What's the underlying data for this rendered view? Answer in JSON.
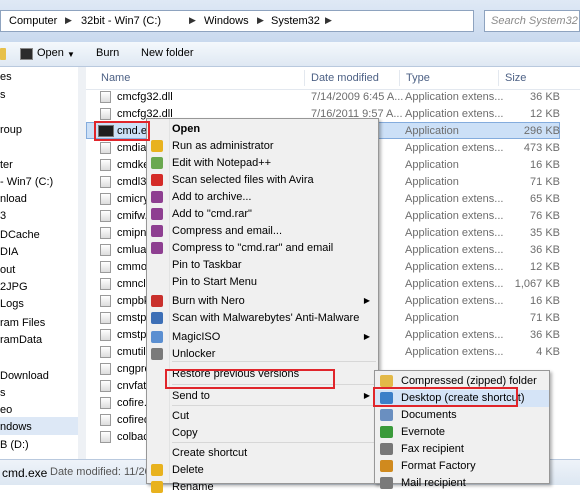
{
  "address": {
    "crumbs": [
      "Computer",
      "32bit - Win7 (C:)",
      "Windows",
      "System32"
    ],
    "search_placeholder": "Search System32"
  },
  "toolbar": {
    "open_label": "Open",
    "burn_label": "Burn",
    "new_folder_label": "New folder"
  },
  "nav": {
    "items": [
      "es",
      "s",
      "roup",
      "",
      "ter",
      "- Win7 (C:)",
      "nload",
      "3",
      "DCache",
      "DIA",
      "out",
      "2JPG",
      "Logs",
      "ram Files",
      "ramData",
      "",
      "Download",
      "s",
      "eo",
      "ndows",
      "B (D:)"
    ]
  },
  "columns": {
    "name": "Name",
    "date": "Date modified",
    "type": "Type",
    "size": "Size"
  },
  "files": [
    {
      "name": "cmcfg32.dll",
      "date": "7/14/2009 6:45 A...",
      "type": "Application extens...",
      "size": "36 KB"
    },
    {
      "name": "cmcfg32.dll",
      "date": "7/16/2011 9:57 A...",
      "type": "Application extens...",
      "size": "12 KB"
    },
    {
      "name": "cmd.ex",
      "date": "",
      "type": "Application",
      "size": "296 KB"
    },
    {
      "name": "cmdial",
      "date": "",
      "type": "Application extens...",
      "size": "473 KB"
    },
    {
      "name": "cmdke",
      "date": "",
      "type": "Application",
      "size": "16 KB"
    },
    {
      "name": "cmdl3",
      "date": "",
      "type": "Application",
      "size": "71 KB"
    },
    {
      "name": "cmicry",
      "date": "",
      "type": "Application extens...",
      "size": "65 KB"
    },
    {
      "name": "cmifw.",
      "date": "",
      "type": "Application extens...",
      "size": "76 KB"
    },
    {
      "name": "cmipnp",
      "date": "",
      "type": "Application extens...",
      "size": "35 KB"
    },
    {
      "name": "cmlua.",
      "date": "",
      "type": "Application extens...",
      "size": "36 KB"
    },
    {
      "name": "cmmo",
      "date": "",
      "type": "Application extens...",
      "size": "12 KB"
    },
    {
      "name": "cmncli",
      "date": "",
      "type": "Application extens...",
      "size": "1,067 KB"
    },
    {
      "name": "cmpbk",
      "date": "",
      "type": "Application extens...",
      "size": "16 KB"
    },
    {
      "name": "cmstp.",
      "date": "",
      "type": "Application",
      "size": "71 KB"
    },
    {
      "name": "cmstpl",
      "date": "",
      "type": "Application extens...",
      "size": "36 KB"
    },
    {
      "name": "cmutil.",
      "date": "",
      "type": "Application extens...",
      "size": "4 KB"
    },
    {
      "name": "cngpro",
      "date": "",
      "type": "",
      "size": ""
    },
    {
      "name": "cnvfat.",
      "date": "",
      "type": "",
      "size": ""
    },
    {
      "name": "cofire.",
      "date": "",
      "type": "",
      "size": ""
    },
    {
      "name": "cofired",
      "date": "",
      "type": "",
      "size": ""
    },
    {
      "name": "colbac",
      "date": "",
      "type": "",
      "size": ""
    }
  ],
  "status": {
    "name": "cmd.exe",
    "date_text": "Date modified: 11/20/"
  },
  "context_menu": {
    "items": [
      {
        "label": "Open",
        "bold": true,
        "icon": "none-icon",
        "color": ""
      },
      {
        "label": "Run as administrator",
        "icon": "shield-icon",
        "color": "#e8b21e"
      },
      {
        "label": "Edit with Notepad++",
        "icon": "notepad-plus-icon",
        "color": "#6aa84f"
      },
      {
        "label": "Scan selected files with Avira",
        "icon": "avira-icon",
        "color": "#d42b27"
      },
      {
        "label": "Add to archive...",
        "icon": "winrar-icon",
        "color": "#8e3f91"
      },
      {
        "label": "Add to \"cmd.rar\"",
        "icon": "winrar-icon",
        "color": "#8e3f91"
      },
      {
        "label": "Compress and email...",
        "icon": "winrar-icon",
        "color": "#8e3f91"
      },
      {
        "label": "Compress to \"cmd.rar\" and email",
        "icon": "winrar-icon",
        "color": "#8e3f91"
      },
      {
        "label": "Pin to Taskbar",
        "icon": "none-icon",
        "color": ""
      },
      {
        "label": "Pin to Start Menu",
        "icon": "none-icon",
        "color": ""
      },
      {
        "label": "Burn with Nero",
        "icon": "nero-icon",
        "color": "#c9302c",
        "arrow": true
      },
      {
        "label": "Scan with Malwarebytes' Anti-Malware",
        "icon": "malwarebytes-icon",
        "color": "#3d6fb6"
      },
      {
        "label": "MagicISO",
        "icon": "magiciso-icon",
        "color": "#5b8fd1",
        "arrow": true
      },
      {
        "label": "Unlocker",
        "icon": "unlocker-icon",
        "color": "#7a7a7a"
      },
      {
        "label": "Restore previous versions",
        "icon": "none-icon",
        "color": ""
      },
      {
        "label": "Send to",
        "icon": "none-icon",
        "color": "",
        "arrow": true
      },
      {
        "label": "Cut",
        "icon": "none-icon",
        "color": ""
      },
      {
        "label": "Copy",
        "icon": "none-icon",
        "color": ""
      },
      {
        "label": "Create shortcut",
        "icon": "none-icon",
        "color": ""
      },
      {
        "label": "Delete",
        "icon": "shield-icon",
        "color": "#e8b21e"
      },
      {
        "label": "Rename",
        "icon": "shield-icon",
        "color": "#e8b21e"
      }
    ]
  },
  "send_to_menu": {
    "items": [
      {
        "label": "Compressed (zipped) folder",
        "icon": "zip-folder-icon",
        "color": "#e3b948"
      },
      {
        "label": "Desktop (create shortcut)",
        "icon": "desktop-icon",
        "color": "#3c7fc8"
      },
      {
        "label": "Documents",
        "icon": "documents-icon",
        "color": "#6a8fc0"
      },
      {
        "label": "Evernote",
        "icon": "evernote-icon",
        "color": "#3a9a3a"
      },
      {
        "label": "Fax recipient",
        "icon": "fax-icon",
        "color": "#777777"
      },
      {
        "label": "Format Factory",
        "icon": "format-factory-icon",
        "color": "#d08a1e"
      },
      {
        "label": "Mail recipient",
        "icon": "mail-icon",
        "color": "#7a7a7a"
      }
    ]
  },
  "colors": {
    "highlight_box": "#e0252b",
    "selection": "#cce0f7"
  }
}
